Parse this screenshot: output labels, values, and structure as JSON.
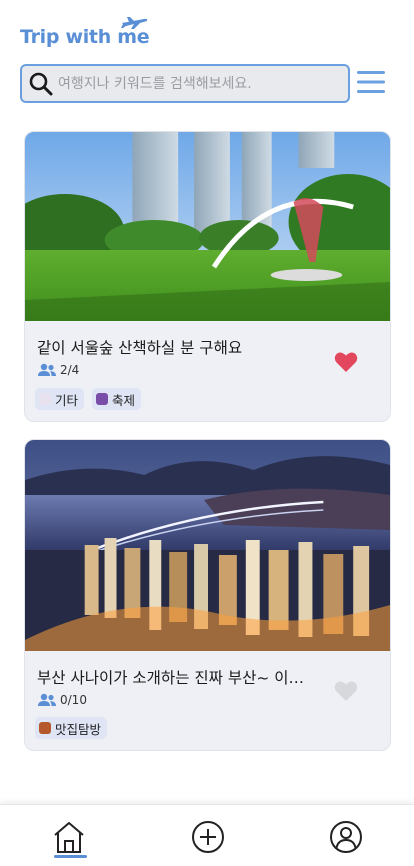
{
  "app": {
    "logo_text": "Trip with me",
    "accent_color": "#5a8fd6",
    "heart_active_color": "#e2475d",
    "heart_inactive_color": "#d7d8dc"
  },
  "search": {
    "placeholder": "여행지나 키워드를 검색해보세요.",
    "value": "",
    "icon": "search-icon"
  },
  "menu": {
    "icon": "hamburger-menu-icon"
  },
  "posts": [
    {
      "title": "같이 서울숲 산책하실 분 구해요",
      "members": "2/4",
      "liked": true,
      "image_description": "park-with-high-rise-towers",
      "tags": [
        {
          "label": "기타",
          "color": "#e7e2ee"
        },
        {
          "label": "축제",
          "color": "#7a4ea8"
        }
      ]
    },
    {
      "title": "부산 사나이가 소개하는 진짜 부산~ 이…",
      "members": "0/10",
      "liked": false,
      "image_description": "busan-night-city-bridge",
      "tags": [
        {
          "label": "맛집탐방",
          "color": "#b5582c"
        }
      ]
    }
  ],
  "bottom_nav": {
    "items": [
      {
        "name": "home",
        "icon": "home-icon",
        "active": true
      },
      {
        "name": "add",
        "icon": "plus-circle-icon",
        "active": false
      },
      {
        "name": "profile",
        "icon": "user-icon",
        "active": false
      }
    ]
  }
}
